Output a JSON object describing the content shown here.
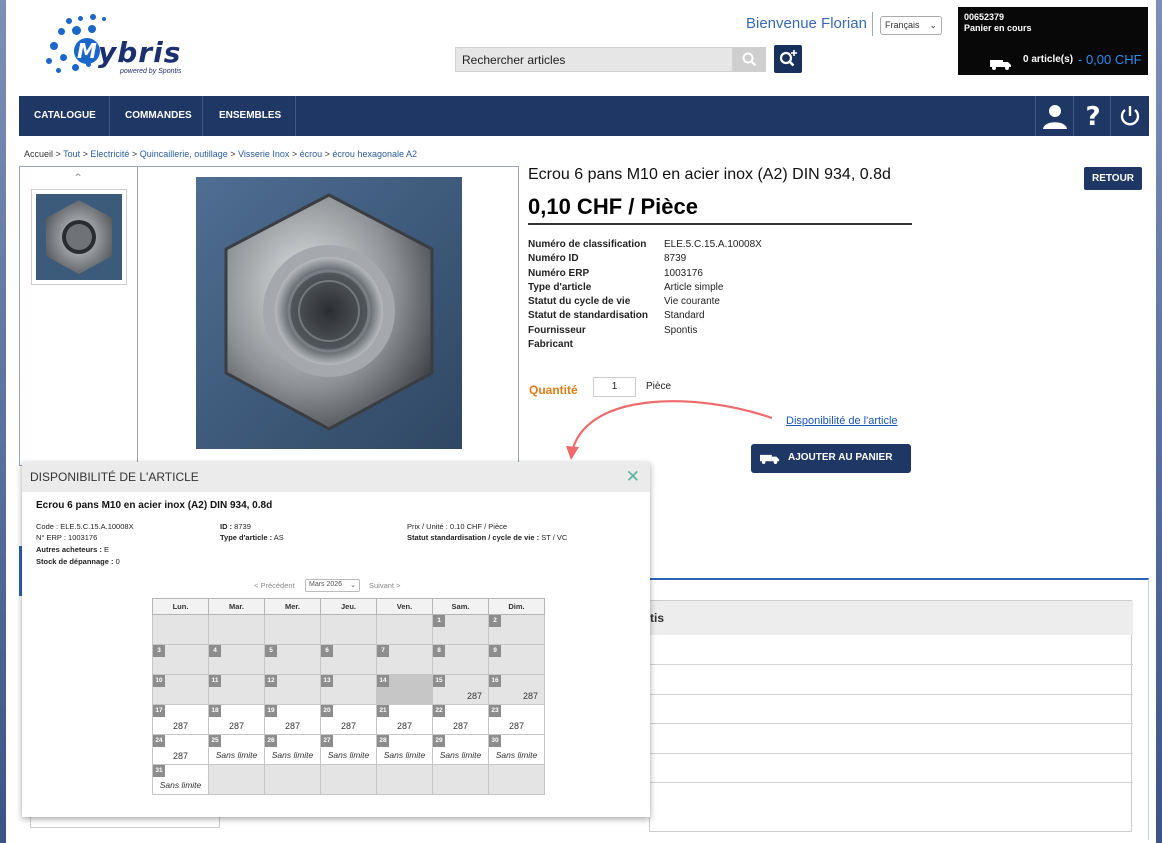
{
  "header": {
    "logo_text": "ybris",
    "logo_letter": "M",
    "logo_sub": "powered by Spontis",
    "welcome": "Bienvenue Florian",
    "language": "Français",
    "search_placeholder": "Rechercher articles",
    "cart": {
      "number": "00652379",
      "status": "Panier en cours",
      "count": "0 article(s)",
      "separator": " - ",
      "total": "0,00 CHF"
    }
  },
  "nav": {
    "items": [
      "CATALOGUE",
      "COMMANDES",
      "ENSEMBLES"
    ]
  },
  "breadcrumb": {
    "items": [
      "Accueil",
      "Tout",
      "Electricité",
      "Quincaillerie, outillage",
      "Visserie Inox",
      "écrou",
      "écrou hexagonale A2"
    ],
    "separator": " > "
  },
  "product": {
    "title": "Ecrou 6 pans M10 en acier inox (A2) DIN 934, 0.8d",
    "price": "0,10 CHF / Pièce",
    "back_label": "RETOUR",
    "attributes": [
      {
        "label": "Numéro de classification",
        "value": "ELE.5.C.15.A.10008X"
      },
      {
        "label": "Numéro ID",
        "value": "8739"
      },
      {
        "label": "Numéro ERP",
        "value": "1003176"
      },
      {
        "label": "Type d'article",
        "value": "Article simple"
      },
      {
        "label": "Statut du cycle de vie",
        "value": "Vie courante"
      },
      {
        "label": "Statut de standardisation",
        "value": "Standard"
      },
      {
        "label": "Fournisseur",
        "value": "Spontis"
      },
      {
        "label": "Fabricant",
        "value": ""
      }
    ],
    "quantity_label": "Quantité",
    "quantity_value": "1",
    "quantity_unit": "Pièce",
    "availability_link": "Disponibilité de l'article",
    "add_to_cart": "AJOUTER AU PANIER"
  },
  "background_table": {
    "header_fragment": "tis"
  },
  "modal": {
    "title": "DISPONIBILITÉ DE L'ARTICLE",
    "close": "✕",
    "product_title": "Ecrou 6 pans M10 en acier inox (A2) DIN 934, 0.8d",
    "code_label": "Code :",
    "code_value": " ELE.5.C.15.A.10008X",
    "erp_label": "N° ERP :",
    "erp_value": " 1003176",
    "buyers_label": "Autres acheteurs :",
    "buyers_value": " E",
    "stock_label": "Stock de dépannage :",
    "stock_value": " 0",
    "id_label": "ID :",
    "id_value": " 8739",
    "type_label": "Type d'article :",
    "type_value": " AS",
    "price_label": "Prix / Unité :",
    "price_value": " 0.10 CHF / Pièce",
    "status_label": "Statut standardisation / cycle de vie :",
    "status_value": " ST / VC",
    "prev": "< Précédent",
    "month": "Mars 2026",
    "next": "Suivant >",
    "days": [
      "Lun.",
      "Mar.",
      "Mer.",
      "Jeu.",
      "Ven.",
      "Sam.",
      "Dim."
    ],
    "weeks": [
      [
        {
          "d": "",
          "q": ""
        },
        {
          "d": "",
          "q": ""
        },
        {
          "d": "",
          "q": ""
        },
        {
          "d": "",
          "q": ""
        },
        {
          "d": "",
          "q": ""
        },
        {
          "d": "1",
          "q": ""
        },
        {
          "d": "2",
          "q": ""
        }
      ],
      [
        {
          "d": "3",
          "q": ""
        },
        {
          "d": "4",
          "q": ""
        },
        {
          "d": "5",
          "q": ""
        },
        {
          "d": "6",
          "q": ""
        },
        {
          "d": "7",
          "q": ""
        },
        {
          "d": "8",
          "q": ""
        },
        {
          "d": "9",
          "q": ""
        }
      ],
      [
        {
          "d": "10",
          "q": ""
        },
        {
          "d": "11",
          "q": ""
        },
        {
          "d": "12",
          "q": ""
        },
        {
          "d": "13",
          "q": ""
        },
        {
          "d": "14",
          "q": "",
          "sel": true
        },
        {
          "d": "15",
          "q": "287"
        },
        {
          "d": "16",
          "q": "287"
        }
      ],
      [
        {
          "d": "17",
          "q": "287",
          "a": true
        },
        {
          "d": "18",
          "q": "287",
          "a": true
        },
        {
          "d": "19",
          "q": "287",
          "a": true
        },
        {
          "d": "20",
          "q": "287",
          "a": true
        },
        {
          "d": "21",
          "q": "287",
          "a": true
        },
        {
          "d": "22",
          "q": "287",
          "a": true
        },
        {
          "d": "23",
          "q": "287",
          "a": true
        }
      ],
      [
        {
          "d": "24",
          "q": "287",
          "a": true
        },
        {
          "d": "25",
          "q": "Sans limite",
          "a": true,
          "s": true
        },
        {
          "d": "26",
          "q": "Sans limite",
          "a": true,
          "s": true
        },
        {
          "d": "27",
          "q": "Sans limite",
          "a": true,
          "s": true
        },
        {
          "d": "28",
          "q": "Sans limite",
          "a": true,
          "s": true
        },
        {
          "d": "29",
          "q": "Sans limite",
          "a": true,
          "s": true
        },
        {
          "d": "30",
          "q": "Sans limite",
          "a": true,
          "s": true
        }
      ],
      [
        {
          "d": "31",
          "q": "Sans limite",
          "a": true,
          "s": true
        },
        {
          "d": "",
          "q": ""
        },
        {
          "d": "",
          "q": ""
        },
        {
          "d": "",
          "q": ""
        },
        {
          "d": "",
          "q": ""
        },
        {
          "d": "",
          "q": ""
        },
        {
          "d": "",
          "q": ""
        }
      ]
    ]
  },
  "colors": {
    "navy": "#1e3764",
    "accent_blue": "#2f8df0",
    "orange": "#e07b14",
    "annotation_arrow": "#ee6b6b",
    "close_green": "#56b39b"
  }
}
